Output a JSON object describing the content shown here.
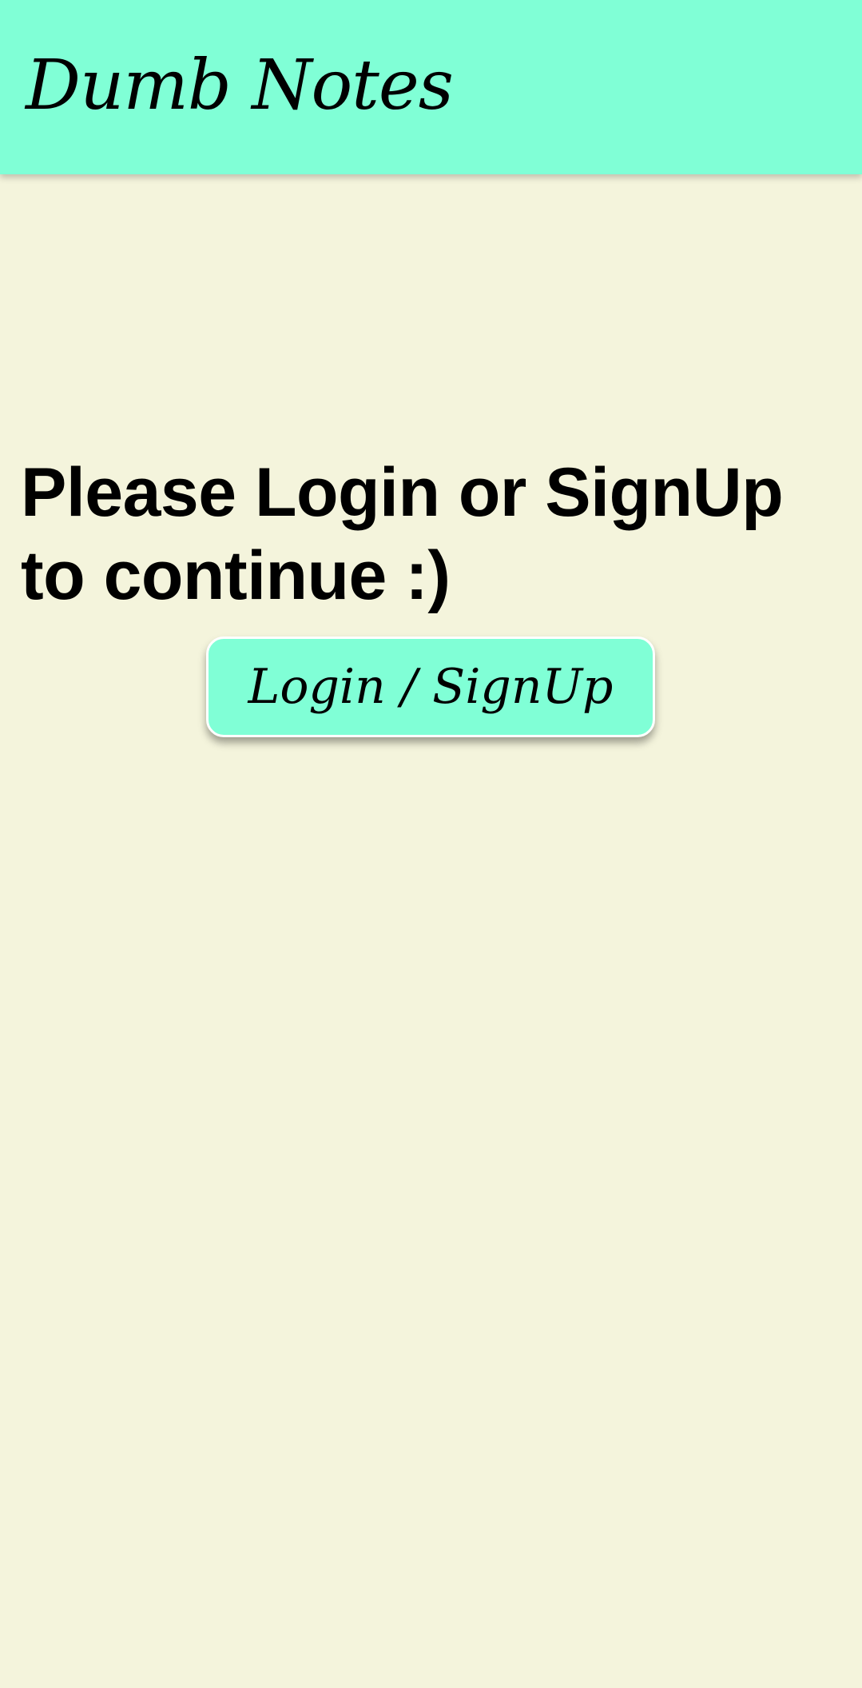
{
  "app_bar": {
    "title": "Dumb Notes"
  },
  "main": {
    "prompt": "Please Login or SignUp to continue :)",
    "login_button_label": "Login / SignUp"
  },
  "colors": {
    "app_bar_background": "#80FFD6",
    "page_background": "#F4F4DC",
    "button_background": "#80FFD6",
    "text": "#000000"
  }
}
